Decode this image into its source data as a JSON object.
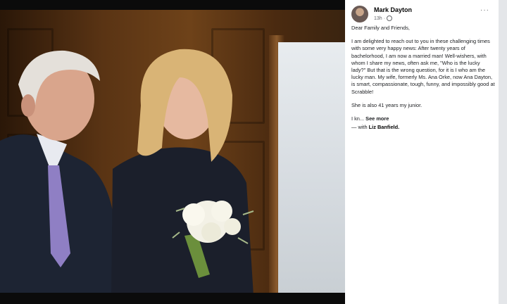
{
  "post": {
    "author": "Mark Dayton",
    "time": "13h",
    "more_label": "···",
    "greeting": "Dear Family and Friends,",
    "paragraph1": "I am delighted to reach out to you in these challenging times with some very happy news: After twenty years of bachelorhood, I am now a married man! Well-wishers, with whom I share my news, often ask me, \"Who is the lucky lady?\" But that is the wrong question, for it is I who am the lucky man. My wife, formerly Ms. Ana Orke, now Ana Dayton, is smart, compassionate, tough, funny, and impossibly good at Scrabble!",
    "paragraph2": "She is also 41 years my junior.",
    "truncated": "I kn...",
    "see_more": "See more",
    "with_prefix": "— with",
    "tagged": "Liz Banfield."
  },
  "icons": {
    "privacy": "globe-icon",
    "options": "more-options-icon"
  }
}
